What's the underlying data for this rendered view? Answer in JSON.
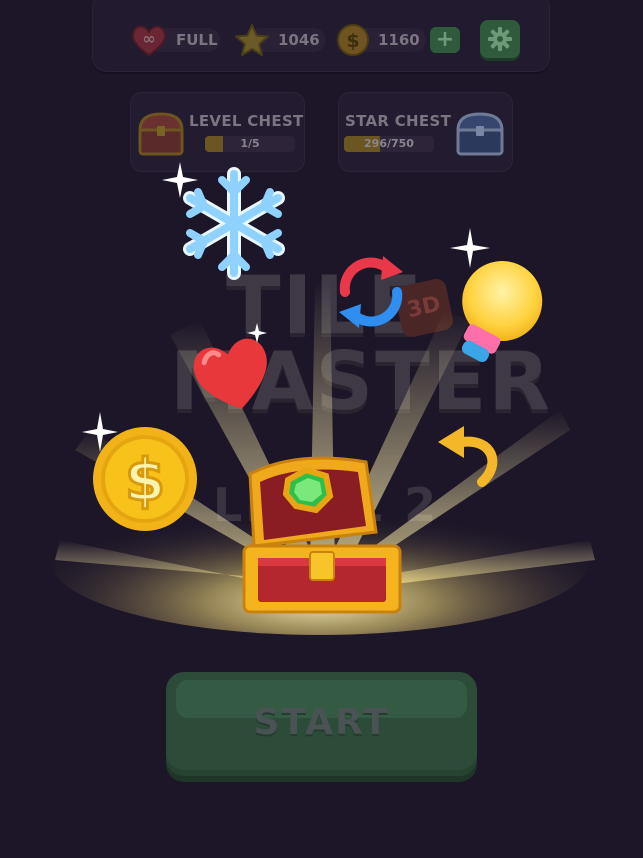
{
  "top_bar": {
    "lives_label": "FULL",
    "lives_infinity": "∞",
    "stars": "1046",
    "coins": "1160",
    "add_coins_label": "+"
  },
  "level_chest": {
    "title": "LEVEL CHEST",
    "progress_text": "1/5",
    "progress_fraction": 0.2
  },
  "star_chest": {
    "title": "STAR CHEST",
    "progress_text": "296/750",
    "progress_fraction": 0.395
  },
  "game_logo": {
    "line1": "TILE",
    "line2": "MASTER",
    "badge": "3D"
  },
  "level_label": "LEVEL 2",
  "start_button": {
    "label": "START"
  },
  "colors": {
    "background": "#1d1628",
    "start_button": "#2c4c39",
    "coin_gold": "#f7c21a",
    "heart_red": "#e8383c",
    "snowflake_blue": "#8fd2ff",
    "bulb_yellow": "#ffd23f"
  },
  "icons": [
    "heart-icon",
    "star-icon",
    "coin-icon",
    "plus-icon",
    "gear-icon",
    "level-chest-icon",
    "star-chest-icon",
    "snowflake-icon",
    "shuffle-icon",
    "lightbulb-icon",
    "heart-reward-icon",
    "coin-reward-icon",
    "undo-icon",
    "treasure-chest-icon"
  ]
}
